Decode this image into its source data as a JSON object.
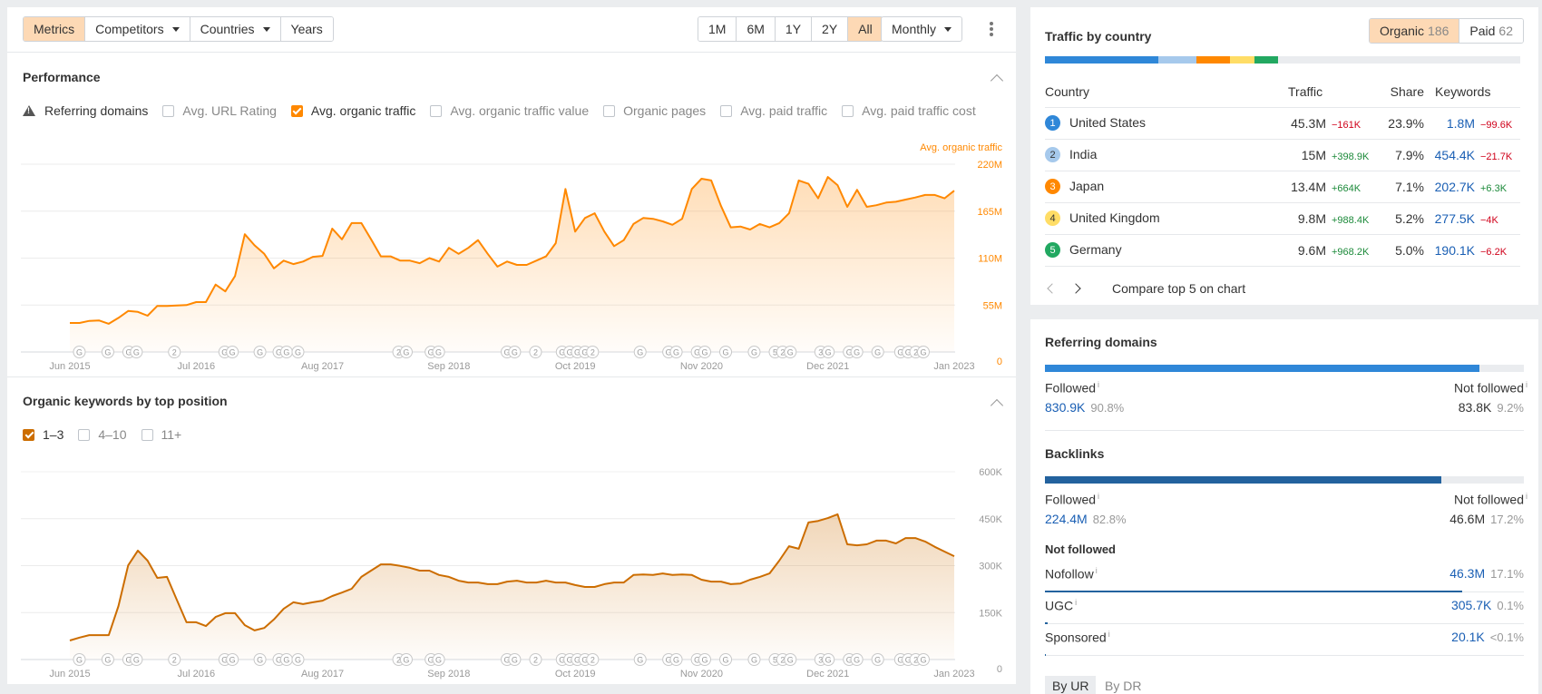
{
  "toolbar": {
    "view_tabs": [
      {
        "label": "Metrics",
        "active": true,
        "dropdown": false
      },
      {
        "label": "Competitors",
        "active": false,
        "dropdown": true
      },
      {
        "label": "Countries",
        "active": false,
        "dropdown": true
      },
      {
        "label": "Years",
        "active": false,
        "dropdown": false
      }
    ],
    "ranges": [
      {
        "label": "1M",
        "active": false
      },
      {
        "label": "6M",
        "active": false
      },
      {
        "label": "1Y",
        "active": false
      },
      {
        "label": "2Y",
        "active": false
      },
      {
        "label": "All",
        "active": true
      }
    ],
    "interval": "Monthly",
    "more_icon": "kebab-vertical-icon"
  },
  "performance": {
    "title": "Performance",
    "metrics": [
      {
        "label": "Referring domains",
        "type": "warning",
        "checked": false
      },
      {
        "label": "Avg. URL Rating",
        "type": "checkbox",
        "checked": false
      },
      {
        "label": "Avg. organic traffic",
        "type": "checkbox",
        "checked": true
      },
      {
        "label": "Avg. organic traffic value",
        "type": "checkbox",
        "checked": false
      },
      {
        "label": "Organic pages",
        "type": "checkbox",
        "checked": false
      },
      {
        "label": "Avg. paid traffic",
        "type": "checkbox",
        "checked": false
      },
      {
        "label": "Avg. paid traffic cost",
        "type": "checkbox",
        "checked": false
      }
    ]
  },
  "keywords": {
    "title": "Organic keywords by top position",
    "filters": [
      {
        "label": "1–3",
        "checked": true
      },
      {
        "label": "4–10",
        "checked": false
      },
      {
        "label": "11+",
        "checked": false
      }
    ]
  },
  "annotation_markers": [
    "G",
    "G",
    "GG",
    "2",
    "GG",
    "G",
    "GG",
    "G",
    "2G",
    "GG",
    "GG",
    "2",
    "GGGG2",
    "G",
    "GG",
    "GG",
    "G",
    "G",
    "52G",
    "3G",
    "GG",
    "G",
    "GG2G",
    "2"
  ],
  "chart_data": [
    {
      "type": "area",
      "title": "Avg. organic traffic",
      "series_label": "Avg. organic traffic",
      "color": "#ff8800",
      "x_start": "Jun 2015",
      "x_end": "Jan 2023",
      "x_unit": "month",
      "x_ticks": [
        "Jun 2015",
        "Jul 2016",
        "Aug 2017",
        "Sep 2018",
        "Oct 2019",
        "Nov 2020",
        "Dec 2021",
        "Jan 2023"
      ],
      "y_ticks": [
        "0",
        "55M",
        "110M",
        "165M",
        "220M"
      ],
      "ylim": [
        0,
        220
      ],
      "y_unit": "M",
      "grid": true,
      "values": [
        34,
        34,
        36.5,
        37,
        33,
        40,
        48,
        47,
        42.5,
        54,
        54,
        54.5,
        55,
        58.5,
        58.5,
        79,
        71,
        89,
        138,
        125,
        115,
        98,
        107,
        103,
        106,
        111.5,
        112.5,
        144.5,
        132,
        151,
        151,
        132,
        112,
        112,
        107,
        107,
        104,
        110,
        106,
        122,
        115,
        122,
        131,
        115,
        100,
        106,
        102,
        102,
        107,
        112,
        127.5,
        191,
        141,
        157,
        162.5,
        141,
        124,
        131,
        150,
        157,
        156,
        153,
        149,
        156,
        191,
        203,
        201,
        171,
        146,
        147,
        143.5,
        150,
        146,
        151,
        162.5,
        201,
        197,
        180,
        205,
        195.5,
        170,
        190,
        170,
        172,
        175,
        176,
        178.5,
        181,
        184,
        184,
        180,
        189
      ]
    },
    {
      "type": "area",
      "title": "Organic keywords by top position",
      "series_label": "1–3",
      "color": "#cc6d00",
      "x_start": "Jun 2015",
      "x_end": "Jan 2023",
      "x_unit": "month",
      "x_ticks": [
        "Jun 2015",
        "Jul 2016",
        "Aug 2017",
        "Sep 2018",
        "Oct 2019",
        "Nov 2020",
        "Dec 2021",
        "Jan 2023"
      ],
      "y_ticks": [
        "0",
        "150K",
        "300K",
        "450K",
        "600K"
      ],
      "ylim": [
        0,
        600
      ],
      "y_unit": "K",
      "grid": true,
      "values": [
        61,
        70,
        78,
        78,
        78,
        171,
        301,
        348,
        316,
        261,
        264,
        191,
        119,
        119,
        107,
        136,
        148,
        148,
        110,
        93,
        101,
        128,
        162,
        183,
        177,
        183,
        188,
        203,
        214,
        226,
        264,
        284,
        304,
        304,
        299,
        293,
        284,
        284,
        270,
        264,
        252,
        246,
        246,
        241,
        241,
        249,
        252,
        246,
        246,
        252,
        246,
        246,
        238,
        232,
        232,
        241,
        246,
        246,
        270,
        272,
        270,
        275,
        270,
        272,
        270,
        255,
        249,
        249,
        241,
        243,
        255,
        264,
        275,
        316,
        362,
        354,
        438,
        443,
        452,
        464,
        368,
        365,
        368,
        380,
        380,
        371,
        388,
        388,
        377,
        360,
        345,
        330
      ]
    }
  ],
  "traffic_by_country": {
    "title": "Traffic by country",
    "toggle": [
      {
        "label": "Organic",
        "count": "186",
        "active": true
      },
      {
        "label": "Paid",
        "count": "62",
        "active": false
      }
    ],
    "share_bar": [
      {
        "country": "United States",
        "share": 23.9,
        "color": "#2f87d8"
      },
      {
        "country": "India",
        "share": 7.9,
        "color": "#a6c9ec"
      },
      {
        "country": "Japan",
        "share": 7.1,
        "color": "#ff8800"
      },
      {
        "country": "United Kingdom",
        "share": 5.2,
        "color": "#ffdd66"
      },
      {
        "country": "Germany",
        "share": 5.0,
        "color": "#22a861"
      }
    ],
    "columns": [
      "Country",
      "Traffic",
      "Share",
      "Keywords"
    ],
    "rows": [
      {
        "rank": "1",
        "country": "United States",
        "traffic": "45.3M",
        "traffic_delta": "−161K",
        "traffic_dir": "neg",
        "share": "23.9%",
        "keywords": "1.8M",
        "keywords_delta": "−99.6K",
        "keywords_dir": "neg",
        "color": "#2f87d8",
        "text_color": "#fff"
      },
      {
        "rank": "2",
        "country": "India",
        "traffic": "15M",
        "traffic_delta": "+398.9K",
        "traffic_dir": "pos",
        "share": "7.9%",
        "keywords": "454.4K",
        "keywords_delta": "−21.7K",
        "keywords_dir": "neg",
        "color": "#a6c9ec",
        "text_color": "#333"
      },
      {
        "rank": "3",
        "country": "Japan",
        "traffic": "13.4M",
        "traffic_delta": "+664K",
        "traffic_dir": "pos",
        "share": "7.1%",
        "keywords": "202.7K",
        "keywords_delta": "+6.3K",
        "keywords_dir": "pos",
        "color": "#ff8800",
        "text_color": "#fff"
      },
      {
        "rank": "4",
        "country": "United Kingdom",
        "traffic": "9.8M",
        "traffic_delta": "+988.4K",
        "traffic_dir": "pos",
        "share": "5.2%",
        "keywords": "277.5K",
        "keywords_delta": "−4K",
        "keywords_dir": "neg",
        "color": "#ffdd66",
        "text_color": "#333"
      },
      {
        "rank": "5",
        "country": "Germany",
        "traffic": "9.6M",
        "traffic_delta": "+968.2K",
        "traffic_dir": "pos",
        "share": "5.0%",
        "keywords": "190.1K",
        "keywords_delta": "−6.2K",
        "keywords_dir": "neg",
        "color": "#22a861",
        "text_color": "#fff"
      }
    ],
    "compare_label": "Compare top 5 on chart"
  },
  "link_profile": {
    "referring_domains": {
      "title": "Referring domains",
      "followed_share": 90.8,
      "followed_label": "Followed",
      "followed_value": "830.9K",
      "followed_pct": "90.8%",
      "not_followed_label": "Not followed",
      "not_followed_value": "83.8K",
      "not_followed_pct": "9.2%",
      "bar_color": "#2f87d8"
    },
    "backlinks": {
      "title": "Backlinks",
      "followed_share": 82.8,
      "followed_label": "Followed",
      "followed_value": "224.4M",
      "followed_pct": "82.8%",
      "not_followed_label": "Not followed",
      "not_followed_value": "46.6M",
      "not_followed_pct": "17.2%",
      "bar_color": "#23629e"
    },
    "not_followed_breakdown": {
      "title": "Not followed",
      "rows": [
        {
          "label": "Nofollow",
          "value": "46.3M",
          "pct": "17.1%",
          "share": 17.1
        },
        {
          "label": "UGC",
          "value": "305.7K",
          "pct": "0.1%",
          "share": 0.1
        },
        {
          "label": "Sponsored",
          "value": "20.1K",
          "pct": "<0.1%",
          "share": 0.05
        }
      ]
    },
    "tabs": [
      {
        "label": "By UR",
        "active": true
      },
      {
        "label": "By DR",
        "active": false
      }
    ]
  }
}
